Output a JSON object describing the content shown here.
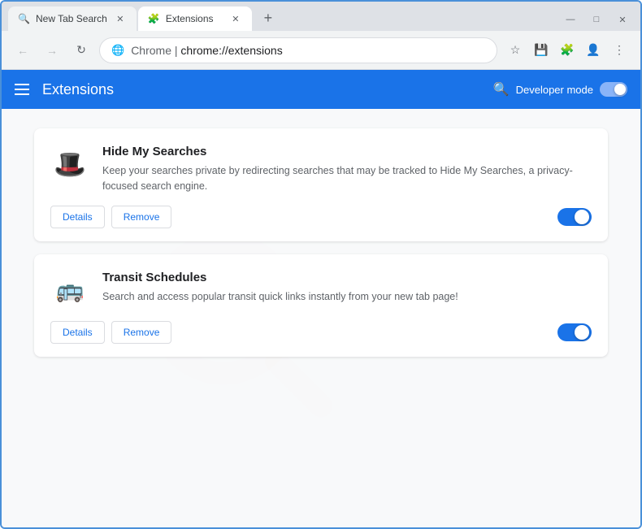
{
  "browser": {
    "tabs": [
      {
        "id": "tab1",
        "label": "New Tab Search",
        "active": false,
        "icon": "🔍"
      },
      {
        "id": "tab2",
        "label": "Extensions",
        "active": true,
        "icon": "🧩"
      }
    ],
    "new_tab_label": "+",
    "window_controls": {
      "minimize": "—",
      "maximize": "□",
      "close": "✕"
    },
    "address_bar": {
      "back_btn": "←",
      "forward_btn": "→",
      "reload_btn": "↻",
      "url_prefix": "Chrome  |  ",
      "url": "chrome://extensions",
      "bookmark_icon": "☆",
      "save_icon": "💾",
      "extensions_icon": "🧩",
      "profile_icon": "👤",
      "menu_icon": "⋮"
    }
  },
  "extensions_page": {
    "header": {
      "menu_icon": "☰",
      "title": "Extensions",
      "search_icon": "🔍",
      "developer_mode_label": "Developer mode",
      "toggle_on": true
    },
    "watermark_text": "fish.com",
    "extensions": [
      {
        "id": "ext1",
        "name": "Hide My Searches",
        "description": "Keep your searches private by redirecting searches that may be tracked to Hide My Searches, a privacy-focused search engine.",
        "icon": "🎩",
        "enabled": true,
        "details_label": "Details",
        "remove_label": "Remove"
      },
      {
        "id": "ext2",
        "name": "Transit Schedules",
        "description": "Search and access popular transit quick links instantly from your new tab page!",
        "icon": "🚌",
        "enabled": true,
        "details_label": "Details",
        "remove_label": "Remove"
      }
    ]
  }
}
